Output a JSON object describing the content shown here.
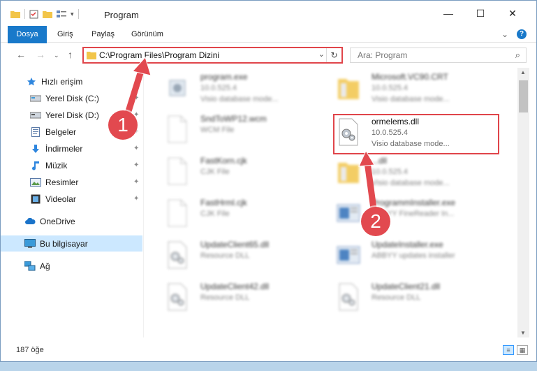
{
  "window": {
    "title": "Program",
    "minimize": "—",
    "maximize": "☐",
    "close": "✕"
  },
  "ribbon": {
    "tabs": [
      "Dosya",
      "Giriş",
      "Paylaş",
      "Görünüm"
    ],
    "help": "?",
    "expand": "⌄"
  },
  "nav": {
    "back": "←",
    "forward": "→",
    "recent": "⌄",
    "up": "↑",
    "address": "C:\\Program Files\\Program Dizini",
    "address_chevron": "⌄",
    "refresh": "↻",
    "search_placeholder": "Ara: Program",
    "search_icon": "⌕"
  },
  "sidebar": {
    "items": [
      {
        "label": "Hızlı erişim",
        "icon": "star-icon"
      },
      {
        "label": "Yerel Disk (C:)",
        "icon": "drive-icon",
        "pinned": true
      },
      {
        "label": "Yerel Disk (D:)",
        "icon": "drive-icon",
        "pinned": true
      },
      {
        "label": "Belgeler",
        "icon": "documents-icon",
        "pinned": true
      },
      {
        "label": "İndirmeler",
        "icon": "download-icon",
        "pinned": true
      },
      {
        "label": "Müzik",
        "icon": "music-icon",
        "pinned": true
      },
      {
        "label": "Resimler",
        "icon": "pictures-icon",
        "pinned": true
      },
      {
        "label": "Videolar",
        "icon": "videos-icon",
        "pinned": true
      },
      {
        "label": "OneDrive",
        "icon": "cloud-icon"
      },
      {
        "label": "Bu bilgisayar",
        "icon": "computer-icon",
        "selected": true
      },
      {
        "label": "Ağ",
        "icon": "network-icon"
      }
    ],
    "pin_glyph": "📌"
  },
  "files": [
    {
      "name": "program.exe",
      "l2": "10.0.525.4",
      "l3": "Visio database mode...",
      "icon": "app-icon",
      "blur": true
    },
    {
      "name": "Microsoft.VC90.CRT",
      "l2": "10.0.525.4",
      "l3": "Visio database mode...",
      "icon": "folder-icon",
      "blur": true
    },
    {
      "name": "SndToWP12.wcm",
      "l2": "WCM File",
      "l3": "",
      "icon": "blank-file-icon",
      "blur": true
    },
    {
      "name": "ormelems.dll",
      "l2": "10.0.525.4",
      "l3": "Visio database mode...",
      "icon": "dll-gear-icon",
      "blur": false
    },
    {
      "name": "FastKorn.cjk",
      "l2": "CJK File",
      "l3": "",
      "icon": "blank-file-icon",
      "blur": true
    },
    {
      "name": "...dll",
      "l2": "10.0.525.4",
      "l3": "Visio database mode...",
      "icon": "folder-icon",
      "blur": true
    },
    {
      "name": "FastHrml.cjk",
      "l2": "CJK File",
      "l3": "",
      "icon": "blank-file-icon",
      "blur": true
    },
    {
      "name": "ProgrammInstaller.exe",
      "l2": "ABBYY FineReader In...",
      "l3": "",
      "icon": "installer-icon",
      "blur": true
    },
    {
      "name": "UpdateClient65.dll",
      "l2": "Resource DLL",
      "l3": "",
      "icon": "dll-gear-icon",
      "blur": true
    },
    {
      "name": "UpdateInstaller.exe",
      "l2": "ABBYY updates installer",
      "l3": "",
      "icon": "installer-icon",
      "blur": true
    },
    {
      "name": "UpdateClient42.dll",
      "l2": "Resource DLL",
      "l3": "",
      "icon": "dll-gear-icon",
      "blur": true
    },
    {
      "name": "UpdateClient21.dll",
      "l2": "Resource DLL",
      "l3": "",
      "icon": "dll-gear-icon",
      "blur": true
    }
  ],
  "status": {
    "count": "187 öğe"
  },
  "annotations": {
    "badge1": "1",
    "badge2": "2"
  },
  "colors": {
    "accent": "#1979ca",
    "highlight": "#e0454a",
    "badge": "#e2494f",
    "selected": "#cce8ff"
  }
}
